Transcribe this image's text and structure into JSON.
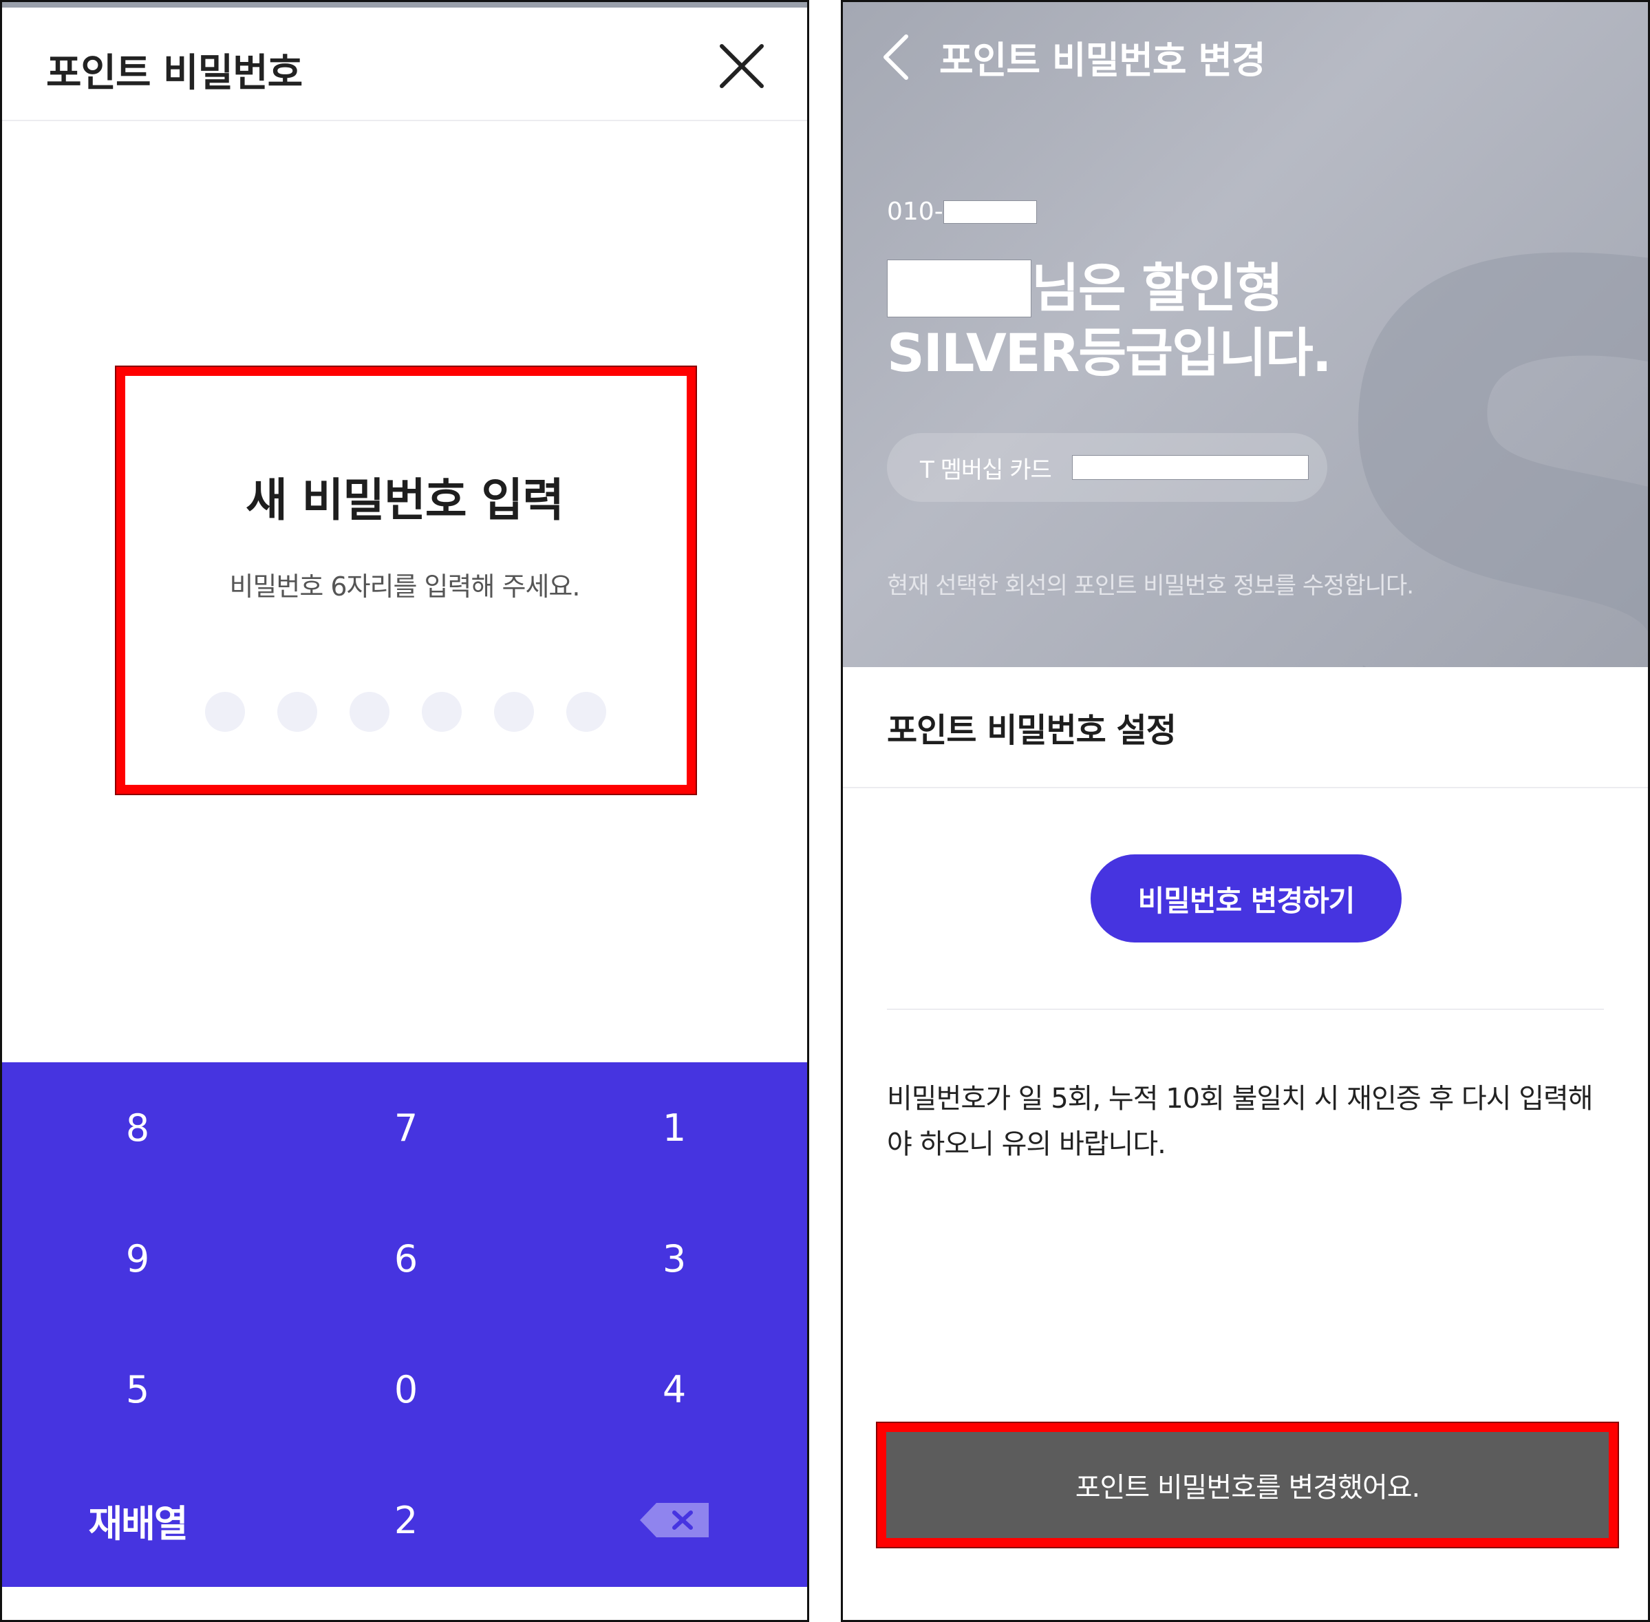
{
  "left_screen": {
    "header": {
      "title": "포인트 비밀번호",
      "close_icon": "close-icon"
    },
    "prompt": {
      "title": "새 비밀번호 입력",
      "subtitle": "비밀번호 6자리를 입력해 주세요.",
      "pin_length": 6,
      "entered": 0
    },
    "keypad": {
      "rows": [
        [
          "8",
          "7",
          "1"
        ],
        [
          "9",
          "6",
          "3"
        ],
        [
          "5",
          "0",
          "4"
        ],
        [
          "재배열",
          "2",
          "backspace-icon"
        ]
      ]
    },
    "colors": {
      "accent": "#4634e0",
      "dot": "#eff0f8",
      "highlight": "#ff0000"
    }
  },
  "right_screen": {
    "header": {
      "title": "포인트 비밀번호 변경",
      "back_icon": "chevron-left-icon"
    },
    "hero": {
      "phone_prefix": "010-",
      "greeting_suffix": "님은 할인형",
      "tier_line": "SILVER등급입니다.",
      "watermark_letter": "S",
      "card_label": "T 멤버십 카드",
      "description": "현재 선택한 회선의 포인트 비밀번호 정보를 수정합니다."
    },
    "section": {
      "title": "포인트 비밀번호 설정"
    },
    "change_button": "비밀번호 변경하기",
    "notice": "비밀번호가 일 5회, 누적 10회 불일치 시 재인증 후 다시 입력해야 하오니 유의 바랍니다.",
    "toast": "포인트 비밀번호를 변경했어요.",
    "colors": {
      "accent": "#4634e0",
      "toast_bg": "#5c5c5c",
      "hero_bg": "#a9adb8"
    }
  }
}
